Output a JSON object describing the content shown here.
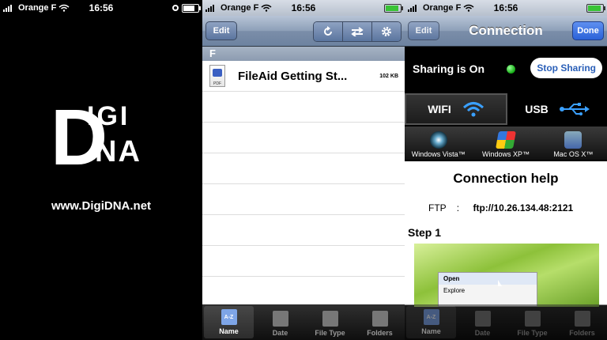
{
  "status": {
    "carrier": "Orange F",
    "time": "16:56"
  },
  "splash": {
    "logo_top": "IGI",
    "logo_bottom": "NA",
    "logo_big_d": "D",
    "url": "www.DigiDNA.net"
  },
  "files": {
    "edit_label": "Edit",
    "section": "F",
    "items": [
      {
        "name": "FileAid Getting St...",
        "size": "102 KB"
      }
    ],
    "tabs": [
      {
        "label": "Name",
        "icon": "A-Z"
      },
      {
        "label": "Date"
      },
      {
        "label": "File Type"
      },
      {
        "label": "Folders"
      }
    ]
  },
  "connection": {
    "edit_label": "Edit",
    "title": "Connection",
    "done_label": "Done",
    "sharing_text": "Sharing is On",
    "stop_label": "Stop Sharing",
    "wifi_label": "WIFI",
    "usb_label": "USB",
    "os": [
      "Windows Vista™",
      "Windows XP™",
      "Mac OS X™"
    ],
    "help_title": "Connection help",
    "ftp_label": "FTP",
    "ftp_sep": ":",
    "ftp_url": "ftp://10.26.134.48:2121",
    "step": "Step 1",
    "menu": [
      "Open",
      "Explore"
    ]
  },
  "colors": {
    "accent": "#2b62d8",
    "status_on": "#22bb22"
  }
}
